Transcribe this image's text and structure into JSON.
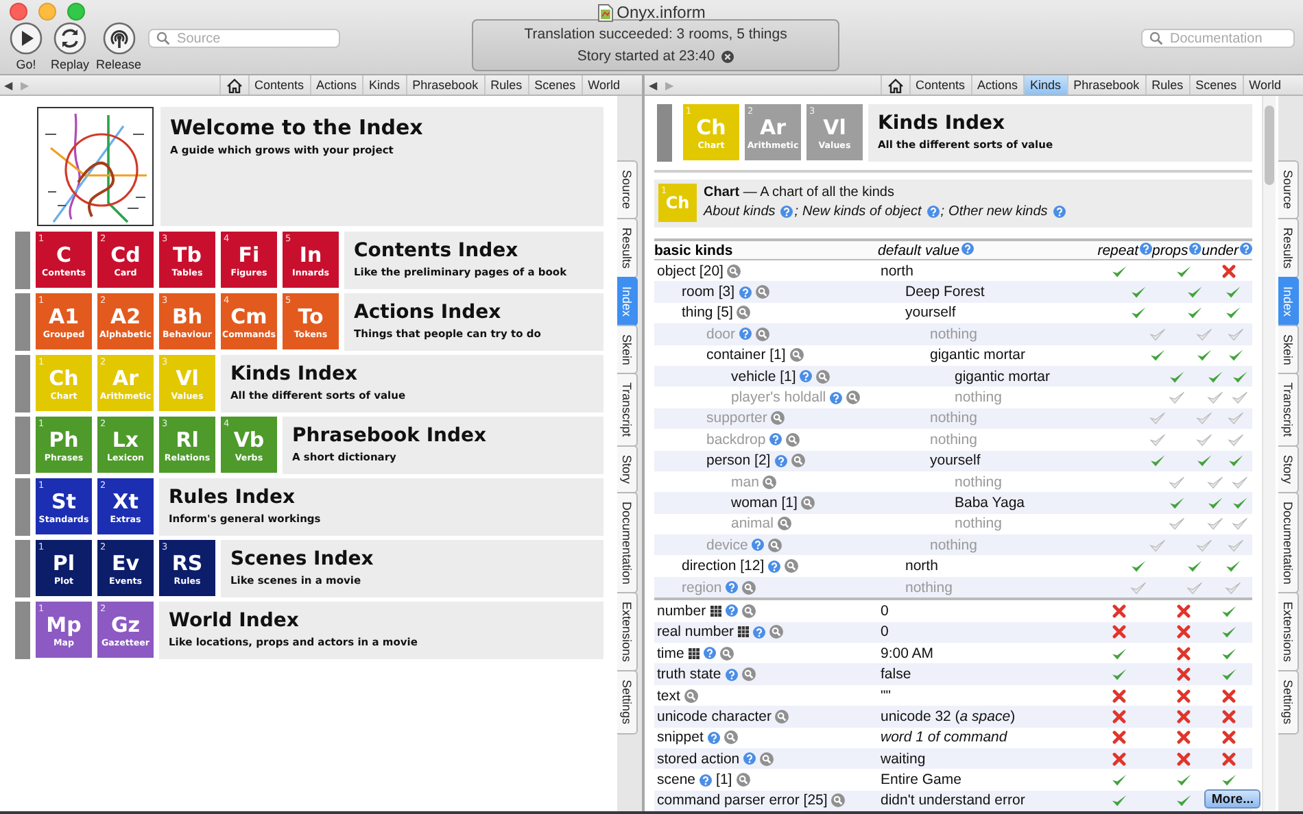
{
  "window": {
    "title": "Onyx.inform"
  },
  "toolbar": {
    "buttons": [
      {
        "label": "Go!",
        "kind": "play"
      },
      {
        "label": "Replay",
        "kind": "replay"
      },
      {
        "label": "Release",
        "kind": "release"
      }
    ],
    "source_search": {
      "placeholder": "Source"
    },
    "status": {
      "lines": [
        "Translation succeeded: 3 rooms, 5 things",
        "Story started at 23:40"
      ]
    },
    "doc_search": {
      "placeholder": "Documentation"
    }
  },
  "left_pane": {
    "nav": {
      "back": "◀",
      "forward": "▶",
      "tabs": [
        {
          "label": "Contents",
          "selected": false
        },
        {
          "label": "Actions",
          "selected": false
        },
        {
          "label": "Kinds",
          "selected": false
        },
        {
          "label": "Phrasebook",
          "selected": false
        },
        {
          "label": "Rules",
          "selected": false
        },
        {
          "label": "Scenes",
          "selected": false
        },
        {
          "label": "World",
          "selected": false
        }
      ]
    },
    "welcome": {
      "title": "Welcome to the Index",
      "subtitle": "A guide which grows with your project"
    },
    "sections": [
      {
        "color": "#c8102e",
        "title": "Contents Index",
        "subtitle": "Like the preliminary pages of a book",
        "tiles": [
          {
            "number": "1",
            "abbr": "C",
            "label": "Contents"
          },
          {
            "number": "2",
            "abbr": "Cd",
            "label": "Card"
          },
          {
            "number": "3",
            "abbr": "Tb",
            "label": "Tables"
          },
          {
            "number": "4",
            "abbr": "Fi",
            "label": "Figures"
          },
          {
            "number": "5",
            "abbr": "In",
            "label": "Innards"
          }
        ]
      },
      {
        "color": "#e35a1e",
        "title": "Actions Index",
        "subtitle": "Things that people can try to do",
        "tiles": [
          {
            "number": "1",
            "abbr": "A1",
            "label": "Grouped"
          },
          {
            "number": "2",
            "abbr": "A2",
            "label": "Alphabetic"
          },
          {
            "number": "3",
            "abbr": "Bh",
            "label": "Behaviour"
          },
          {
            "number": "4",
            "abbr": "Cm",
            "label": "Commands"
          },
          {
            "number": "5",
            "abbr": "To",
            "label": "Tokens"
          }
        ]
      },
      {
        "color": "#e2c800",
        "title": "Kinds Index",
        "subtitle": "All the different sorts of value",
        "tiles": [
          {
            "number": "1",
            "abbr": "Ch",
            "label": "Chart"
          },
          {
            "number": "2",
            "abbr": "Ar",
            "label": "Arithmetic"
          },
          {
            "number": "3",
            "abbr": "Vl",
            "label": "Values"
          }
        ]
      },
      {
        "color": "#4e9a2b",
        "title": "Phrasebook Index",
        "subtitle": "A short dictionary",
        "tiles": [
          {
            "number": "1",
            "abbr": "Ph",
            "label": "Phrases"
          },
          {
            "number": "2",
            "abbr": "Lx",
            "label": "Lexicon"
          },
          {
            "number": "3",
            "abbr": "Rl",
            "label": "Relations"
          },
          {
            "number": "4",
            "abbr": "Vb",
            "label": "Verbs"
          }
        ]
      },
      {
        "color": "#1c2fb2",
        "title": "Rules Index",
        "subtitle": "Inform's general workings",
        "tiles": [
          {
            "number": "1",
            "abbr": "St",
            "label": "Standards"
          },
          {
            "number": "2",
            "abbr": "Xt",
            "label": "Extras"
          }
        ]
      },
      {
        "color": "#0c1d6a",
        "title": "Scenes Index",
        "subtitle": "Like scenes in a movie",
        "tiles": [
          {
            "number": "1",
            "abbr": "Pl",
            "label": "Plot"
          },
          {
            "number": "2",
            "abbr": "Ev",
            "label": "Events"
          },
          {
            "number": "3",
            "abbr": "RS",
            "label": "Rules"
          }
        ]
      },
      {
        "color": "#8c5ac2",
        "title": "World Index",
        "subtitle": "Like locations, props and actors in a movie",
        "tiles": [
          {
            "number": "1",
            "abbr": "Mp",
            "label": "Map"
          },
          {
            "number": "2",
            "abbr": "Gz",
            "label": "Gazetteer"
          }
        ]
      }
    ],
    "side_tabs": [
      {
        "label": "Source",
        "selected": false
      },
      {
        "label": "Results",
        "selected": false
      },
      {
        "label": "Index",
        "selected": true
      },
      {
        "label": "Skein",
        "selected": false
      },
      {
        "label": "Transcript",
        "selected": false
      },
      {
        "label": "Story",
        "selected": false
      },
      {
        "label": "Documentation",
        "selected": false
      },
      {
        "label": "Extensions",
        "selected": false
      },
      {
        "label": "Settings",
        "selected": false
      }
    ]
  },
  "right_pane": {
    "nav": {
      "back": "◀",
      "forward": "▶",
      "tabs": [
        {
          "label": "Contents",
          "selected": false
        },
        {
          "label": "Actions",
          "selected": false
        },
        {
          "label": "Kinds",
          "selected": true
        },
        {
          "label": "Phrasebook",
          "selected": false
        },
        {
          "label": "Rules",
          "selected": false
        },
        {
          "label": "Scenes",
          "selected": false
        },
        {
          "label": "World",
          "selected": false
        }
      ]
    },
    "header": {
      "color": "#e2c800",
      "title": "Kinds Index",
      "subtitle": "All the different sorts of value",
      "tiles": [
        {
          "number": "1",
          "abbr": "Ch",
          "label": "Chart",
          "selected": true
        },
        {
          "number": "2",
          "abbr": "Ar",
          "label": "Arithmetic",
          "selected": false
        },
        {
          "number": "3",
          "abbr": "Vl",
          "label": "Values",
          "selected": false
        }
      ]
    },
    "chart_box": {
      "number": "1",
      "abbr": "Ch",
      "heading": "**Chart** — A chart of all the kinds",
      "separator": ";",
      "links": [
        "About kinds",
        "New kinds of object",
        "Other new kinds"
      ]
    },
    "table": {
      "columns": [
        {
          "label": "basic kinds",
          "help": false
        },
        {
          "label": "default value",
          "help": true
        },
        {
          "label": "repeat",
          "help": true
        },
        {
          "label": "props",
          "help": true
        },
        {
          "label": "under",
          "help": true
        }
      ],
      "groups": [
        {
          "rows": [
            {
              "name": "object [20]",
              "help": false,
              "grid": false,
              "dimmed": false,
              "value": "north",
              "italic": false,
              "repeat": true,
              "props": true,
              "under": false,
              "children": [
                {
                  "name": "room [3]",
                  "help": true,
                  "grid": false,
                  "dimmed": false,
                  "value": "Deep Forest",
                  "italic": false,
                  "repeat": true,
                  "props": true,
                  "under": true
                },
                {
                  "name": "thing [5]",
                  "help": false,
                  "grid": false,
                  "dimmed": false,
                  "value": "yourself",
                  "italic": false,
                  "repeat": true,
                  "props": true,
                  "under": true,
                  "children": [
                    {
                      "name": "door",
                      "help": true,
                      "grid": false,
                      "dimmed": true,
                      "value": "nothing",
                      "italic": false,
                      "repeat": true,
                      "props": true,
                      "under": true
                    },
                    {
                      "name": "container [1]",
                      "help": false,
                      "grid": false,
                      "dimmed": false,
                      "value": "gigantic mortar",
                      "italic": false,
                      "repeat": true,
                      "props": true,
                      "under": true,
                      "children": [
                        {
                          "name": "vehicle [1]",
                          "help": true,
                          "grid": false,
                          "dimmed": false,
                          "value": "gigantic mortar",
                          "italic": false,
                          "repeat": true,
                          "props": true,
                          "under": true
                        },
                        {
                          "name": "player's holdall",
                          "help": true,
                          "grid": false,
                          "dimmed": true,
                          "value": "nothing",
                          "italic": false,
                          "repeat": true,
                          "props": true,
                          "under": true
                        }
                      ]
                    },
                    {
                      "name": "supporter",
                      "help": false,
                      "grid": false,
                      "dimmed": true,
                      "value": "nothing",
                      "italic": false,
                      "repeat": true,
                      "props": true,
                      "under": true
                    },
                    {
                      "name": "backdrop",
                      "help": true,
                      "grid": false,
                      "dimmed": true,
                      "value": "nothing",
                      "italic": false,
                      "repeat": true,
                      "props": true,
                      "under": true
                    },
                    {
                      "name": "person [2]",
                      "help": true,
                      "grid": false,
                      "dimmed": false,
                      "value": "yourself",
                      "italic": false,
                      "repeat": true,
                      "props": true,
                      "under": true,
                      "children": [
                        {
                          "name": "man",
                          "help": false,
                          "grid": false,
                          "dimmed": true,
                          "value": "nothing",
                          "italic": false,
                          "repeat": true,
                          "props": true,
                          "under": true
                        },
                        {
                          "name": "woman [1]",
                          "help": false,
                          "grid": false,
                          "dimmed": false,
                          "value": "Baba Yaga",
                          "italic": false,
                          "repeat": true,
                          "props": true,
                          "under": true
                        },
                        {
                          "name": "animal",
                          "help": false,
                          "grid": false,
                          "dimmed": true,
                          "value": "nothing",
                          "italic": false,
                          "repeat": true,
                          "props": true,
                          "under": true
                        }
                      ]
                    },
                    {
                      "name": "device",
                      "help": true,
                      "grid": false,
                      "dimmed": true,
                      "value": "nothing",
                      "italic": false,
                      "repeat": true,
                      "props": true,
                      "under": true
                    }
                  ]
                },
                {
                  "name": "direction [12]",
                  "help": true,
                  "grid": false,
                  "dimmed": false,
                  "value": "north",
                  "italic": false,
                  "repeat": true,
                  "props": true,
                  "under": true
                },
                {
                  "name": "region",
                  "help": true,
                  "grid": false,
                  "dimmed": true,
                  "value": "nothing",
                  "italic": false,
                  "repeat": true,
                  "props": true,
                  "under": true
                }
              ]
            }
          ]
        },
        {
          "rows": [
            {
              "name": "number",
              "help": true,
              "grid": true,
              "dimmed": false,
              "value": "0",
              "italic": false,
              "repeat": false,
              "props": false,
              "under": true
            },
            {
              "name": "real number",
              "help": true,
              "grid": true,
              "dimmed": false,
              "value": "0",
              "italic": false,
              "repeat": false,
              "props": false,
              "under": true
            },
            {
              "name": "time",
              "help": true,
              "grid": true,
              "dimmed": false,
              "value": "9:00 AM",
              "italic": false,
              "repeat": true,
              "props": false,
              "under": true
            },
            {
              "name": "truth state",
              "help": true,
              "grid": false,
              "dimmed": false,
              "value": "false",
              "italic": false,
              "repeat": true,
              "props": false,
              "under": true
            },
            {
              "name": "text",
              "help": false,
              "grid": false,
              "dimmed": false,
              "value": "\"\"",
              "italic": false,
              "repeat": false,
              "props": false,
              "under": false
            },
            {
              "name": "unicode character",
              "help": false,
              "grid": false,
              "dimmed": false,
              "value": "unicode 32 (*a space*)",
              "italic": false,
              "repeat": false,
              "props": false,
              "under": false
            },
            {
              "name": "snippet",
              "help": true,
              "grid": false,
              "dimmed": false,
              "value": "word 1 of command",
              "italic": true,
              "repeat": false,
              "props": false,
              "under": false
            },
            {
              "name": "stored action",
              "help": true,
              "grid": false,
              "dimmed": false,
              "value": "waiting",
              "italic": false,
              "repeat": false,
              "props": false,
              "under": false
            },
            {
              "name": "scene",
              "help": true,
              "suffix": "[1]",
              "grid": false,
              "dimmed": false,
              "value": "Entire Game",
              "italic": false,
              "repeat": true,
              "props": true,
              "under": true
            },
            {
              "name": "command parser error [25]",
              "help": false,
              "grid": false,
              "dimmed": false,
              "value": "didn't understand error",
              "italic": false,
              "repeat": true,
              "props": true
            }
          ]
        }
      ],
      "more_button": "More..."
    },
    "side_tabs": [
      {
        "label": "Source",
        "selected": false
      },
      {
        "label": "Results",
        "selected": false
      },
      {
        "label": "Index",
        "selected": true
      },
      {
        "label": "Skein",
        "selected": false
      },
      {
        "label": "Transcript",
        "selected": false
      },
      {
        "label": "Story",
        "selected": false
      },
      {
        "label": "Documentation",
        "selected": false
      },
      {
        "label": "Extensions",
        "selected": false
      },
      {
        "label": "Settings",
        "selected": false
      }
    ]
  }
}
